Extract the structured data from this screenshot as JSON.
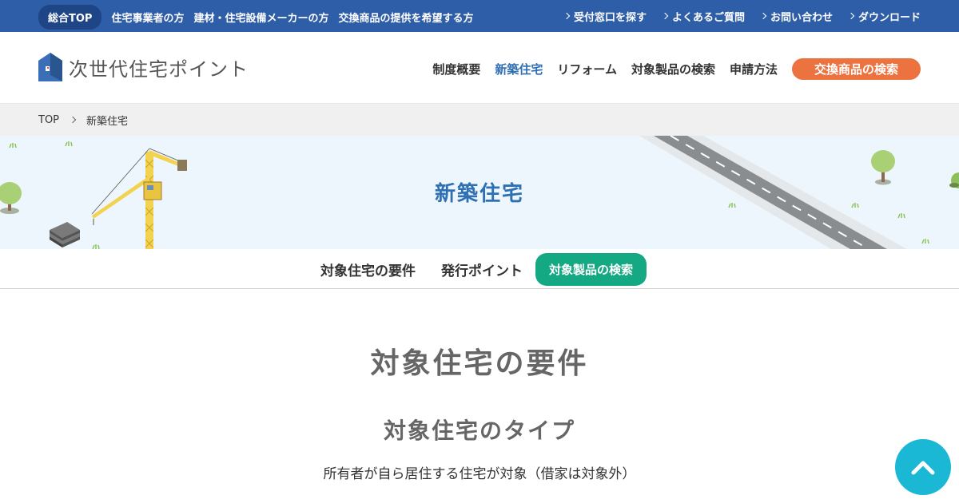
{
  "topbar": {
    "left_items": [
      "総合TOP",
      "住宅事業者の方",
      "建材・住宅設備メーカーの方",
      "交換商品の提供を希望する方"
    ],
    "right_items": [
      "受付窓口を探す",
      "よくあるご質問",
      "お問い合わせ",
      "ダウンロード"
    ]
  },
  "header": {
    "logo_text": "次世代住宅ポイント",
    "nav": [
      "制度概要",
      "新築住宅",
      "リフォーム",
      "対象製品の検索",
      "申請方法"
    ],
    "cta": "交換商品の検索"
  },
  "breadcrumb": {
    "home": "TOP",
    "current": "新築住宅"
  },
  "hero": {
    "title": "新築住宅"
  },
  "tabs": [
    "対象住宅の要件",
    "発行ポイント",
    "対象製品の検索"
  ],
  "main": {
    "title": "対象住宅の要件",
    "subtitle": "対象住宅のタイプ",
    "description": "所有者が自ら居住する住宅が対象（借家は対象外）"
  },
  "colors": {
    "topbar": "#2f5ea8",
    "accent_orange": "#ec7340",
    "accent_green": "#14a883",
    "accent_blue": "#2f6fb3",
    "scroll_button": "#1bb8d6"
  }
}
